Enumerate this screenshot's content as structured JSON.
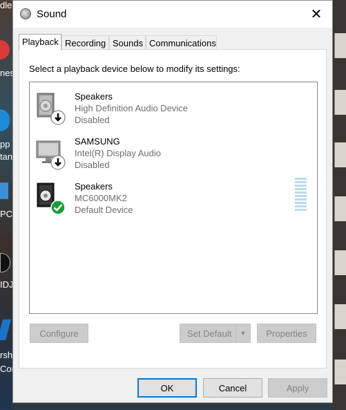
{
  "window": {
    "title": "Sound",
    "close_glyph": "✕"
  },
  "tabs": [
    {
      "label": "Playback",
      "active": true
    },
    {
      "label": "Recording",
      "active": false
    },
    {
      "label": "Sounds",
      "active": false
    },
    {
      "label": "Communications",
      "active": false
    }
  ],
  "instruction": "Select a playback device below to modify its settings:",
  "devices": [
    {
      "name": "Speakers",
      "driver": "High Definition Audio Device",
      "status": "Disabled",
      "icon": "speaker-icon",
      "badge": "disabled-arrow-icon"
    },
    {
      "name": "SAMSUNG",
      "driver": "Intel(R) Display Audio",
      "status": "Disabled",
      "icon": "monitor-icon",
      "badge": "disabled-arrow-icon"
    },
    {
      "name": "Speakers",
      "driver": "MC6000MK2",
      "status": "Default Device",
      "icon": "speaker-icon",
      "badge": "default-check-icon"
    }
  ],
  "buttons": {
    "configure": "Configure",
    "set_default": "Set Default",
    "properties": "Properties",
    "ok": "OK",
    "cancel": "Cancel",
    "apply": "Apply"
  },
  "desktop": {
    "left_labels": [
      "dle",
      "nes",
      "pp",
      "tan",
      "PC",
      "IDJ",
      "rsh",
      "Cor"
    ],
    "accent_check": "#1a9e3a",
    "accent_focus": "#0078d7"
  }
}
